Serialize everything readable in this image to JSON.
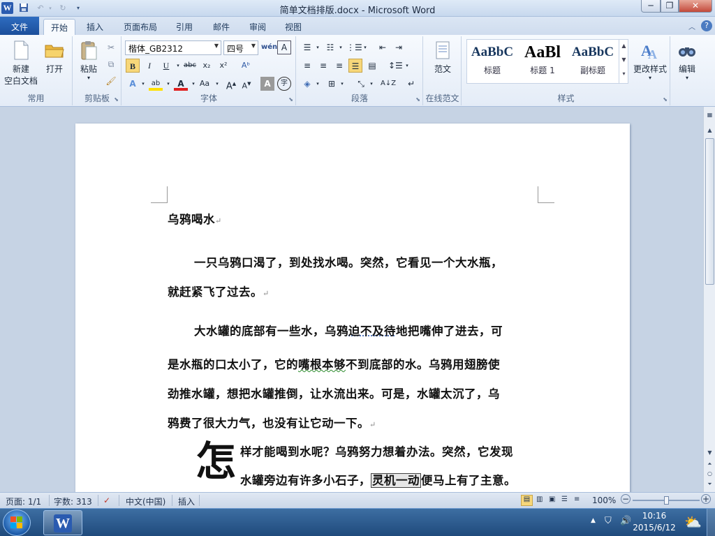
{
  "window": {
    "title": "简单文档排版.docx - Microsoft Word",
    "min": "─",
    "max": "❐",
    "close": "✕"
  },
  "tabs": {
    "file": "文件",
    "items": [
      "开始",
      "插入",
      "页面布局",
      "引用",
      "邮件",
      "审阅",
      "视图"
    ],
    "active": "开始"
  },
  "ribbon": {
    "common": {
      "new_label_1": "新建",
      "new_label_2": "空白文档",
      "open_label": "打开",
      "group": "常用"
    },
    "clipboard": {
      "paste_label": "粘贴",
      "group": "剪贴板"
    },
    "font": {
      "font_name": "楷体_GB2312",
      "font_size": "四号",
      "group": "字体",
      "bold": "B",
      "italic": "I",
      "underline": "U",
      "strike": "abc",
      "sub": "x₂",
      "sup": "x²",
      "change_case": "Aa",
      "grow": "A",
      "shrink": "A",
      "char_shade": "A",
      "enclose": "字"
    },
    "paragraph": {
      "group": "段落"
    },
    "online_template": {
      "template_label": "范文",
      "group": "在线范文"
    },
    "styles": {
      "group": "样式",
      "items": [
        {
          "sample": "AaBbC",
          "name": "标题"
        },
        {
          "sample": "AaBl",
          "name": "标题 1"
        },
        {
          "sample": "AaBbC",
          "name": "副标题"
        }
      ],
      "change_styles": "更改样式"
    },
    "editing": {
      "label": "编辑"
    }
  },
  "document": {
    "title": "乌鸦喝水",
    "para1_line1": "一只乌鸦口渴了，到处找水喝。突然，它看见一个大水瓶，",
    "para1_line2": "就赶紧飞了过去。",
    "para2_line1_a": "大水罐的底部有一些水，乌鸦",
    "para2_line1_b": "迫不及待",
    "para2_line1_c": "地把嘴伸了进去，可",
    "para2_line2_a": "是水瓶的口太小了，它的",
    "para2_line2_b": "嘴根本够",
    "para2_line2_c": "不到底部的水。乌鸦用翅膀使",
    "para2_line3": "劲推水罐，想把水罐推倒，让水流出来。可是，水罐太沉了，乌",
    "para2_line4": "鸦费了很大力气，也没有让它动一下。",
    "dropcap": "怎",
    "para3_line1": "样才能喝到水呢？乌鸦努力想着办法。突然，它发现",
    "para3_line2_a": "水罐旁边有许多小石子，",
    "para3_line2_b": "灵机一动",
    "para3_line2_c": "便马上有了主意。"
  },
  "status": {
    "page": "页面: 1/1",
    "words": "字数: 313",
    "language": "中文(中国)",
    "insert_mode": "插入",
    "zoom": "100%",
    "zoom_value": 100
  },
  "taskbar": {
    "time": "10:16",
    "date": "2015/6/12"
  },
  "colors": {
    "file_tab": "#2a62b5",
    "ribbon_bg": "#eef3fa",
    "doc_bg": "#c6d3e4",
    "font_color_red": "#e02020",
    "highlight_yellow": "#ffe000"
  }
}
